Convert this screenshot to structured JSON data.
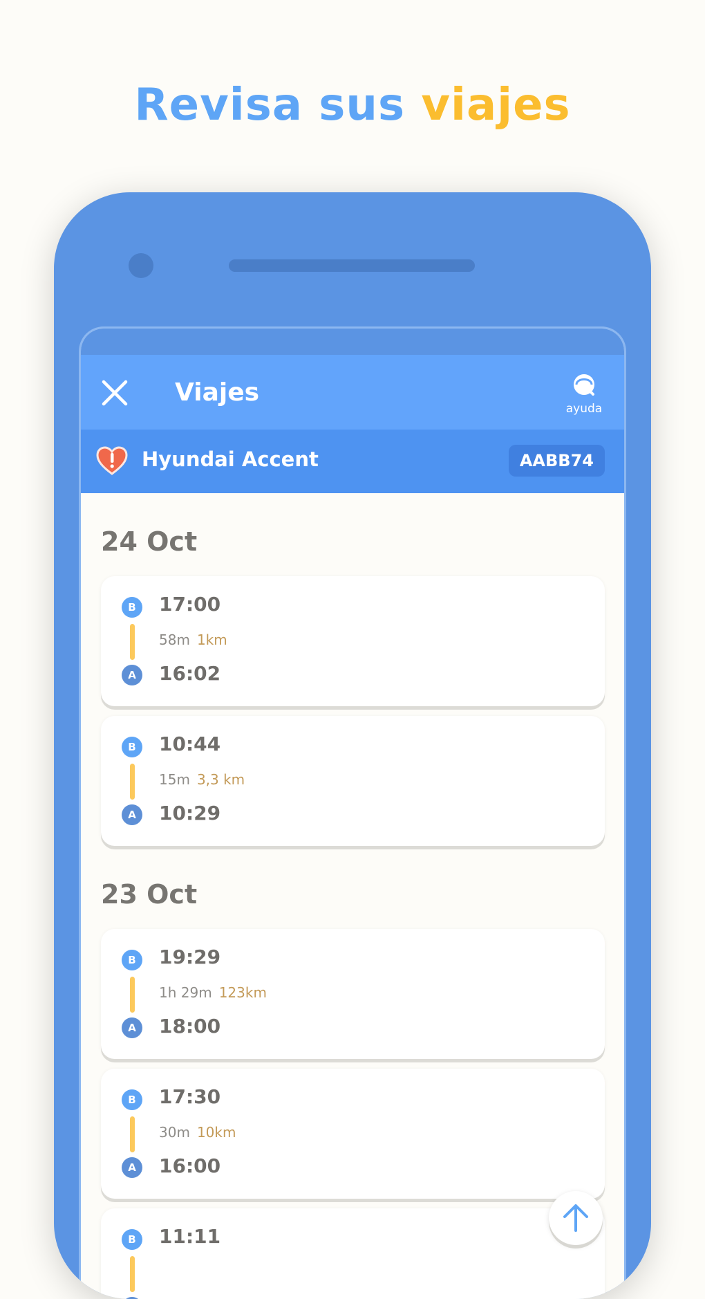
{
  "headline": {
    "part1": "Revisa sus",
    "part2": "viajes"
  },
  "appbar": {
    "title": "Viajes",
    "help_label": "ayuda"
  },
  "vehicle": {
    "name": "Hyundai Accent",
    "plate": "AABB74"
  },
  "trip_groups": [
    {
      "date": "24 Oct",
      "trips": [
        {
          "start_badge": "A",
          "end_badge": "B",
          "end_time": "17:00",
          "start_time": "16:02",
          "duration": "58m",
          "distance": "1km"
        },
        {
          "start_badge": "A",
          "end_badge": "B",
          "end_time": "10:44",
          "start_time": "10:29",
          "duration": "15m",
          "distance": "3,3 km"
        }
      ]
    },
    {
      "date": "23 Oct",
      "trips": [
        {
          "start_badge": "A",
          "end_badge": "B",
          "end_time": "19:29",
          "start_time": "18:00",
          "duration": "1h 29m",
          "distance": "123km"
        },
        {
          "start_badge": "A",
          "end_badge": "B",
          "end_time": "17:30",
          "start_time": "16:00",
          "duration": "30m",
          "distance": "10km"
        },
        {
          "start_badge": "A",
          "end_badge": "B",
          "end_time": "11:11",
          "start_time": "",
          "duration": "",
          "distance": ""
        }
      ]
    }
  ],
  "colors": {
    "headline_blue": "#5ea5f6",
    "headline_yellow": "#fbbd2f",
    "phone_body": "#5b94e3",
    "appbar": "#62a4fb",
    "vehicle_bar": "#4e93f1",
    "route_line": "#fcc95c",
    "distance_text": "#c39a58",
    "alert_heart": "#f0684b"
  },
  "icons": {
    "close": "close-icon",
    "help": "headset-icon",
    "vehicle_status": "heart-alert-icon",
    "scroll_top": "arrow-up-icon"
  }
}
